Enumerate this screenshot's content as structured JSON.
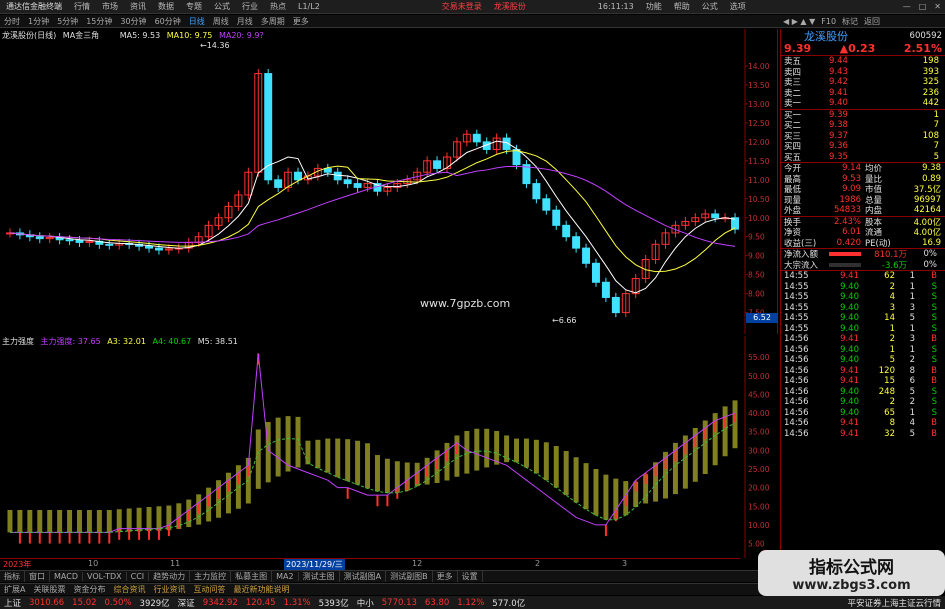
{
  "menubar": {
    "app": "通达信金融终端",
    "items": [
      "行情",
      "市场",
      "资讯",
      "数据",
      "专题",
      "公式",
      "行业",
      "热点",
      "L1/L2"
    ],
    "login": "交易未登录",
    "stock": "龙溪股份",
    "time": "16:11:13",
    "right": [
      "功能",
      "帮助",
      "公式",
      "选项"
    ]
  },
  "toolbar": {
    "items": [
      "分时",
      "1分钟",
      "5分钟",
      "15分钟",
      "30分钟",
      "60分钟",
      "日线",
      "周线",
      "月线",
      "多周期",
      "更多"
    ],
    "active": "日线",
    "right": [
      "F10",
      "标记",
      "返回"
    ]
  },
  "chart_header": {
    "name": "龙溪股份(日线)",
    "indicator": "MA金三角",
    "ma5": "MA5: 9.53",
    "ma10": "MA10: 9.75",
    "ma20": "MA20: 9.9?"
  },
  "price_labels": {
    "high": "14.36",
    "low": "6.66",
    "site": "www.7gpzb.com",
    "marker": "6.52"
  },
  "sub_header": {
    "name": "主力强度",
    "v1": "主力强度: 37.65",
    "v2": "A3: 32.01",
    "v3": "A4: 40.67",
    "v4": "M5: 38.51"
  },
  "date_label": "2023/11/29/三",
  "date_start": "2023年",
  "date_ticks": [
    "10",
    "11",
    "12",
    "2",
    "3"
  ],
  "bottom_tabs": [
    "指标",
    "窗口",
    "MACD",
    "VOL-TDX",
    "CCI",
    "趋势动力",
    "主力监控",
    "私募主图",
    "MA2",
    "测试主图",
    "测试副图A",
    "测试副图B",
    "更多",
    "设置"
  ],
  "bottom_tabs2": [
    "扩展A",
    "关联股票",
    "资金分布",
    "综合资讯",
    "行业资讯",
    "互动问答",
    "最近新功能说明"
  ],
  "quote": {
    "name": "龙溪股份",
    "code": "600592",
    "price": "9.39",
    "change": "▲0.23",
    "pct": "2.51%",
    "asks": [
      {
        "label": "卖五",
        "price": "9.44",
        "vol": "198"
      },
      {
        "label": "卖四",
        "price": "9.43",
        "vol": "393"
      },
      {
        "label": "卖三",
        "price": "9.42",
        "vol": "325"
      },
      {
        "label": "卖二",
        "price": "9.41",
        "vol": "236"
      },
      {
        "label": "卖一",
        "price": "9.40",
        "vol": "442"
      }
    ],
    "bids": [
      {
        "label": "买一",
        "price": "9.39",
        "vol": "1"
      },
      {
        "label": "买二",
        "price": "9.38",
        "vol": "7"
      },
      {
        "label": "买三",
        "price": "9.37",
        "vol": "108"
      },
      {
        "label": "买四",
        "price": "9.36",
        "vol": "7"
      },
      {
        "label": "买五",
        "price": "9.35",
        "vol": "5"
      }
    ],
    "stats": [
      {
        "l1": "今开",
        "v1": "9.14",
        "l2": "均价",
        "v2": "9.38"
      },
      {
        "l1": "最高",
        "v1": "9.53",
        "l2": "量比",
        "v2": "0.89"
      },
      {
        "l1": "最低",
        "v1": "9.09",
        "l2": "市值",
        "v2": "37.5亿"
      },
      {
        "l1": "现量",
        "v1": "1986",
        "l2": "总量",
        "v2": "96997"
      },
      {
        "l1": "外盘",
        "v1": "54833",
        "l2": "内盘",
        "v2": "42164"
      }
    ],
    "stats2": [
      {
        "l1": "换手",
        "v1": "2.43%",
        "l2": "股本",
        "v2": "4.00亿"
      },
      {
        "l1": "净资",
        "v1": "6.01",
        "l2": "流通",
        "v2": "4.00亿"
      },
      {
        "l1": "收益(三)",
        "v1": "0.420",
        "l2": "PE(动)",
        "v2": "16.9"
      }
    ],
    "flow": [
      {
        "l": "净流入额",
        "v": "810.1万",
        "p": "0%"
      },
      {
        "l": "大宗流入",
        "v": "-3.6万",
        "p": "0%"
      }
    ],
    "ticks": [
      {
        "t": "14:55",
        "p": "9.41",
        "v": "62",
        "n": "1",
        "s": "B"
      },
      {
        "t": "14:55",
        "p": "9.40",
        "v": "2",
        "n": "1",
        "s": "S"
      },
      {
        "t": "14:55",
        "p": "9.40",
        "v": "4",
        "n": "1",
        "s": "S"
      },
      {
        "t": "14:55",
        "p": "9.40",
        "v": "3",
        "n": "3",
        "s": "S"
      },
      {
        "t": "14:55",
        "p": "9.40",
        "v": "14",
        "n": "5",
        "s": "S"
      },
      {
        "t": "14:55",
        "p": "9.40",
        "v": "1",
        "n": "1",
        "s": "S"
      },
      {
        "t": "14:56",
        "p": "9.41",
        "v": "2",
        "n": "3",
        "s": "B"
      },
      {
        "t": "14:56",
        "p": "9.40",
        "v": "1",
        "n": "1",
        "s": "S"
      },
      {
        "t": "14:56",
        "p": "9.40",
        "v": "5",
        "n": "2",
        "s": "S"
      },
      {
        "t": "14:56",
        "p": "9.41",
        "v": "120",
        "n": "8",
        "s": "B"
      },
      {
        "t": "14:56",
        "p": "9.41",
        "v": "15",
        "n": "6",
        "s": "B"
      },
      {
        "t": "14:56",
        "p": "9.40",
        "v": "248",
        "n": "5",
        "s": "S"
      },
      {
        "t": "14:56",
        "p": "9.40",
        "v": "2",
        "n": "2",
        "s": "S"
      },
      {
        "t": "14:56",
        "p": "9.40",
        "v": "65",
        "n": "1",
        "s": "S"
      },
      {
        "t": "14:56",
        "p": "9.41",
        "v": "8",
        "n": "4",
        "s": "B"
      },
      {
        "t": "14:56",
        "p": "9.41",
        "v": "32",
        "n": "5",
        "s": "B"
      }
    ]
  },
  "status": {
    "sh_label": "上证",
    "sh_val": "3010.66",
    "sh_chg": "15.02",
    "sh_pct": "0.50%",
    "sh_amt": "3929亿",
    "sz_label": "深证",
    "sz_val": "9342.92",
    "sz_chg": "120.45",
    "sz_pct": "1.31%",
    "sz_amt": "5393亿",
    "zx_label": "中小",
    "zx_val": "5770.13",
    "zx_chg": "63.80",
    "zx_pct": "1.12%",
    "zx_amt": "577.0亿",
    "broker": "平安证券上海主证云行情"
  },
  "watermark": {
    "t1": "指标公式网",
    "t2": "www.zbgs3.com"
  },
  "chart_data": {
    "type": "line",
    "title": "龙溪股份(日线)",
    "y_ticks_main": [
      "14.00",
      "13.50",
      "13.00",
      "12.50",
      "12.00",
      "11.50",
      "11.00",
      "10.50",
      "10.00",
      "9.50",
      "9.00",
      "8.50",
      "8.00",
      "7.50"
    ],
    "y_ticks_sub": [
      "55.00",
      "50.00",
      "45.00",
      "40.00",
      "35.00",
      "30.00",
      "25.00",
      "20.00",
      "15.00",
      "10.00",
      "5.00"
    ],
    "ylim_main": [
      7.2,
      14.5
    ],
    "ylim_sub": [
      3,
      58
    ],
    "close": [
      9.6,
      9.55,
      9.5,
      9.45,
      9.48,
      9.42,
      9.4,
      9.35,
      9.38,
      9.3,
      9.28,
      9.32,
      9.3,
      9.25,
      9.2,
      9.15,
      9.18,
      9.2,
      9.35,
      9.5,
      9.8,
      10.0,
      10.3,
      10.6,
      11.2,
      13.8,
      11.0,
      10.8,
      11.2,
      11.0,
      11.1,
      11.3,
      11.2,
      11.0,
      10.9,
      10.8,
      10.9,
      10.7,
      10.8,
      10.9,
      11.0,
      11.2,
      11.5,
      11.3,
      11.6,
      12.0,
      12.2,
      12.0,
      11.8,
      12.1,
      11.8,
      11.4,
      10.9,
      10.5,
      10.2,
      9.8,
      9.5,
      9.2,
      8.8,
      8.3,
      7.9,
      7.5,
      8.0,
      8.4,
      8.9,
      9.3,
      9.6,
      9.8,
      9.9,
      10.0,
      10.1,
      10.0,
      10.0,
      9.7
    ],
    "strength": [
      8,
      8,
      8,
      8,
      8,
      8,
      8,
      8,
      8,
      8,
      8,
      9,
      9,
      9,
      9,
      9,
      10,
      12,
      14,
      16,
      18,
      20,
      22,
      24,
      26,
      56,
      30,
      28,
      26,
      25,
      24,
      23,
      22,
      20,
      20,
      19,
      18,
      18,
      18,
      20,
      22,
      24,
      26,
      28,
      30,
      32,
      30,
      29,
      28,
      27,
      26,
      24,
      22,
      20,
      18,
      16,
      14,
      12,
      11,
      10,
      10,
      14,
      18,
      22,
      24,
      26,
      28,
      30,
      32,
      34,
      36,
      38,
      39,
      40
    ]
  }
}
